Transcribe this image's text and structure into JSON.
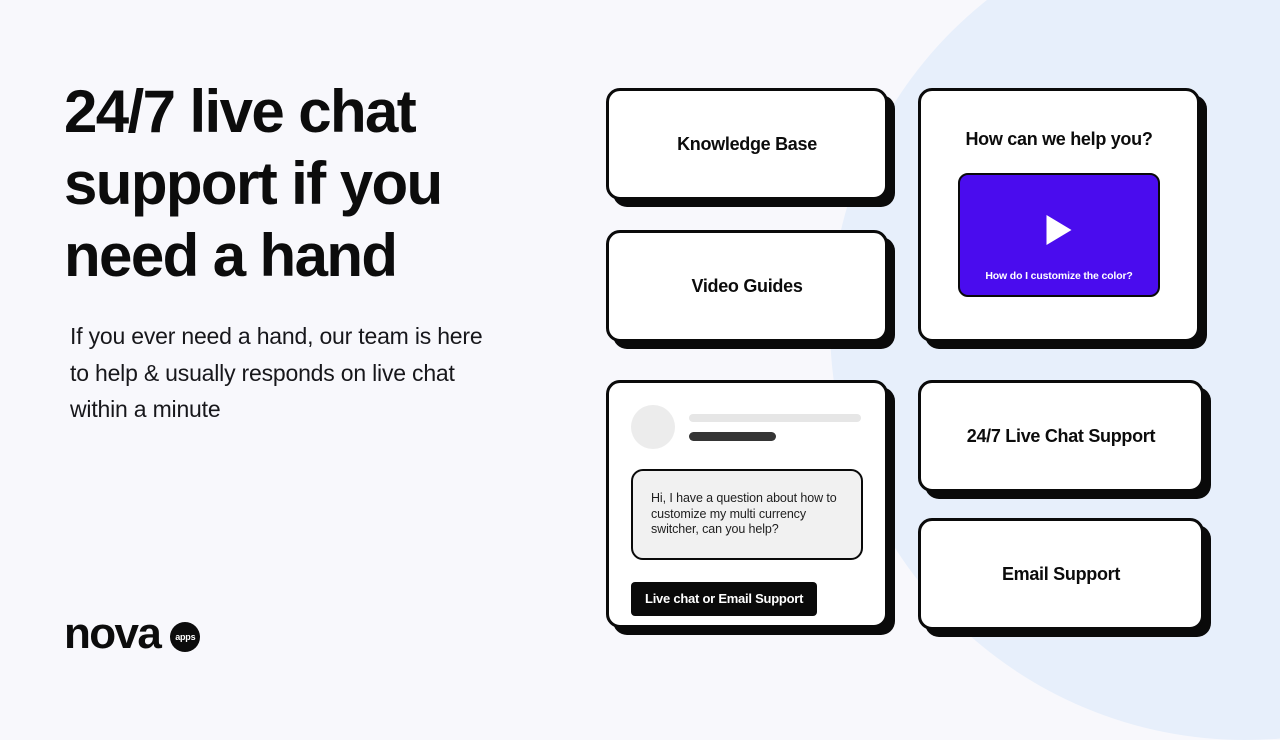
{
  "page": {
    "background_color": "#f8f8fc",
    "accent_circle_color": "#e7effb",
    "brand_purple": "#4a0cee",
    "ink": "#0a0a0a"
  },
  "hero": {
    "headline": "24/7 live chat support if you need a hand",
    "subcopy": "If you ever need a hand, our team is here to help & usually responds on live chat within a minute"
  },
  "logo": {
    "wordmark": "nova",
    "badge_label": "apps"
  },
  "cards": {
    "knowledge_base": {
      "label": "Knowledge Base"
    },
    "video_guides": {
      "label": "Video Guides"
    },
    "live_chat_support": {
      "label": "24/7 Live Chat Support"
    },
    "email_support": {
      "label": "Email Support"
    },
    "help": {
      "title": "How can we help you?",
      "video": {
        "caption": "How do I customize the color?",
        "play_icon": "play-icon",
        "background_color": "#4a0cee"
      }
    },
    "chat": {
      "avatar_icon": "avatar-placeholder-icon",
      "message": "Hi, I have a question about how to customize my multi currency switcher, can you help?",
      "cta_label": "Live chat or Email Support"
    }
  }
}
